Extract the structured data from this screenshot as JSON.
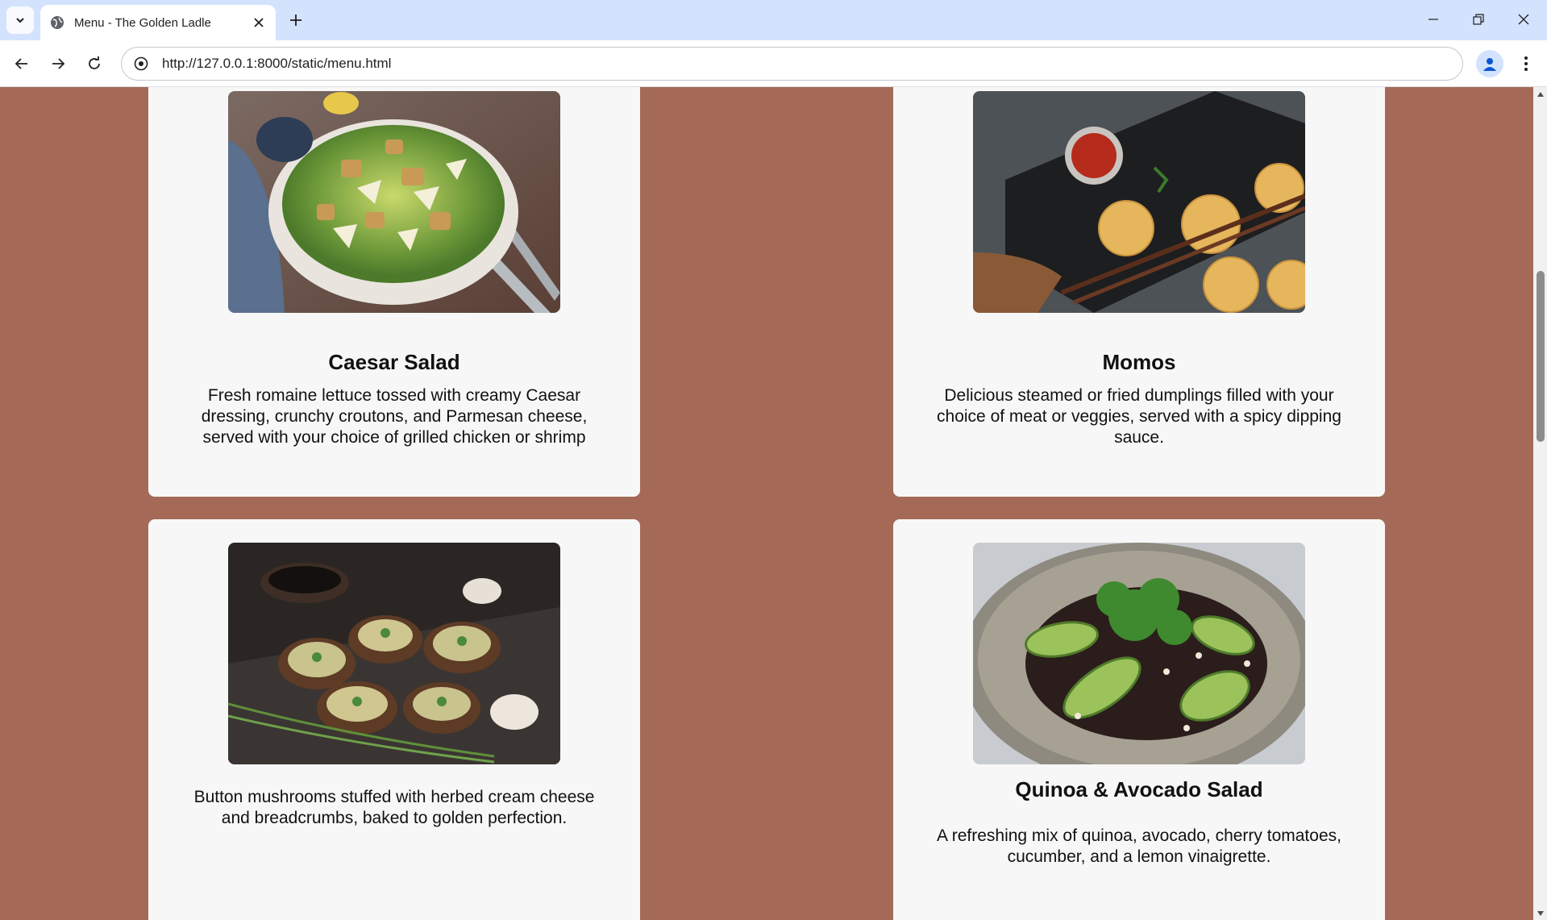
{
  "browser": {
    "tab_title": "Menu - The Golden Ladle",
    "url": "http://127.0.0.1:8000/static/menu.html",
    "accent": "#d3e3fd"
  },
  "page": {
    "background": "#a56a57",
    "card_background": "#f7f7f7"
  },
  "menu_items": [
    {
      "name": "Caesar Salad",
      "description": "Fresh romaine lettuce tossed with creamy Caesar dressing, crunchy croutons, and Parmesan cheese, served with your choice of grilled chicken or shrimp",
      "image": "caesar-salad-photo"
    },
    {
      "name": "Momos",
      "description": "Delicious steamed or fried dumplings filled with your choice of meat or veggies, served with a spicy dipping sauce.",
      "image": "momos-photo"
    },
    {
      "name": "",
      "description": "Button mushrooms stuffed with herbed cream cheese and breadcrumbs, baked to golden perfection.",
      "image": "stuffed-mushrooms-photo"
    },
    {
      "name": "Quinoa & Avocado Salad",
      "description": "A refreshing mix of quinoa, avocado, cherry tomatoes, cucumber, and a lemon vinaigrette.",
      "image": "quinoa-avocado-salad-photo"
    }
  ],
  "icons": {
    "tab_list": "chevron-down-icon",
    "favicon": "globe-icon",
    "close_tab": "close-icon",
    "new_tab": "plus-icon",
    "minimize": "minimize-icon",
    "restore": "restore-icon",
    "close_window": "close-icon",
    "back": "arrow-left-icon",
    "forward": "arrow-right-icon",
    "reload": "reload-icon",
    "site_info": "site-info-icon",
    "profile": "person-icon",
    "menu": "more-vert-icon"
  }
}
